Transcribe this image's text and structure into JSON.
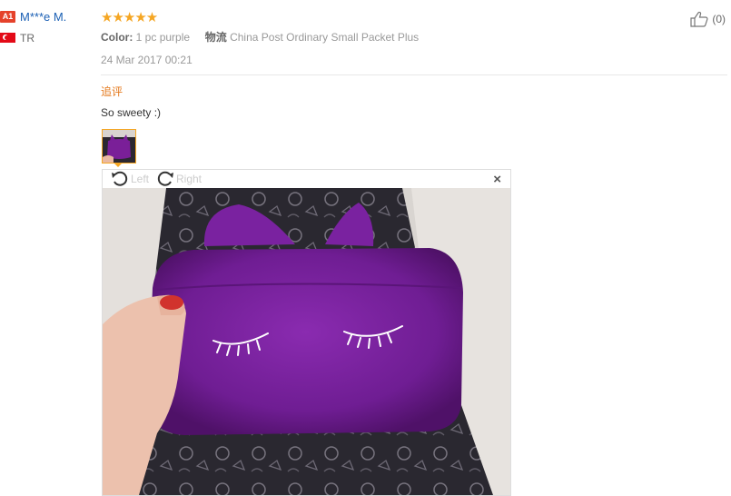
{
  "user": {
    "level_badge": "A1",
    "name": "M***e M.",
    "flag_icon": "turkey-flag-icon",
    "country": "TR"
  },
  "review": {
    "rating": 5,
    "stars": "★★★★★",
    "color_label": "Color:",
    "color_value": "1 pc purple",
    "shipping_label": "物流",
    "shipping_value": "China Post Ordinary Small Packet Plus",
    "date": "24 Mar 2017 00:21",
    "followup_label": "追评",
    "followup_text": "So sweety :)"
  },
  "helpful": {
    "icon": "thumbs-up-icon",
    "count": "(0)"
  },
  "viewer": {
    "rotate_left_label": "Left",
    "rotate_right_label": "Right",
    "close_label": "×"
  },
  "colors": {
    "accent_orange": "#f5a623",
    "followup_orange": "#e4791c",
    "link_blue": "#1a5fb4",
    "badge_red": "#e5422b",
    "bag_purple": "#6c1f9a"
  }
}
